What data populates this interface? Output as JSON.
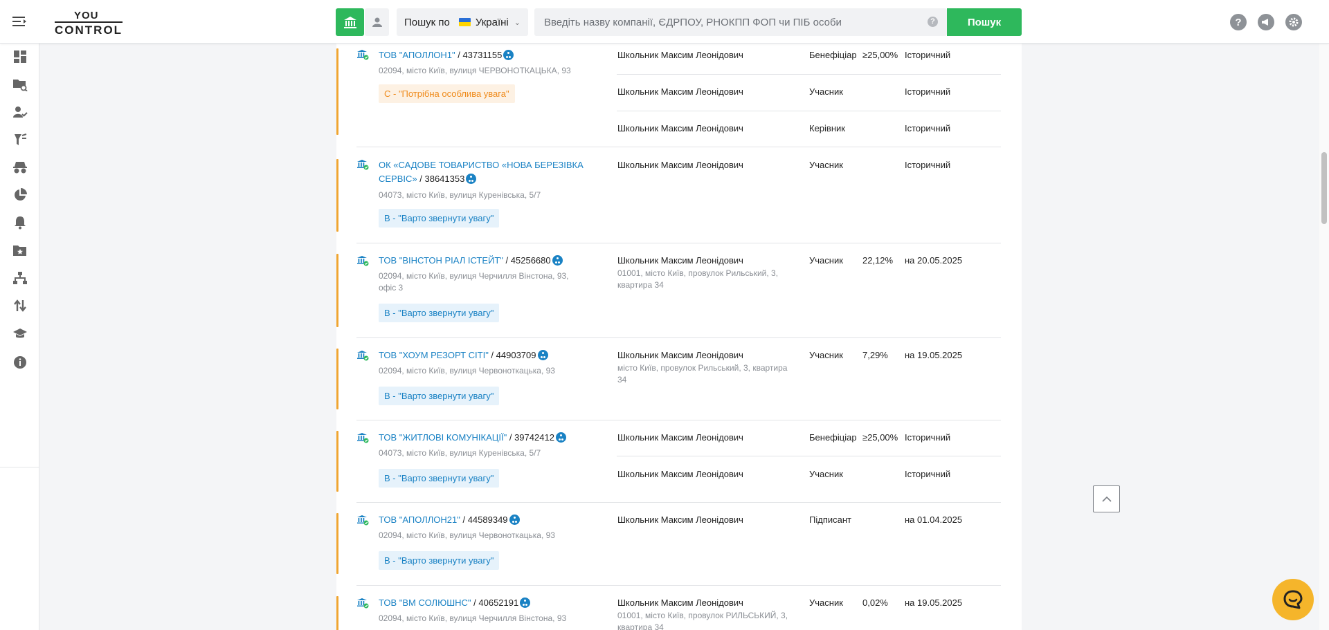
{
  "header": {
    "logo_top": "YOU",
    "logo_bottom": "CONTROL",
    "search_scope_label": "Пошук по",
    "country": "Україні",
    "search_placeholder": "Введіть назву компанії, ЄДРПОУ, РНОКПП ФОП чи ПІБ особи",
    "search_help": "?",
    "search_button": "Пошук",
    "icons": [
      "help-icon",
      "announcement-icon",
      "settings-icon"
    ],
    "accent_color": "#2eb85c"
  },
  "sidebar": {
    "icons": [
      "dashboard-icon",
      "folder-search-icon",
      "user-check-icon",
      "filter-icon",
      "spy-icon",
      "pie-chart-icon",
      "bell-icon",
      "folder-star-icon",
      "hierarchy-icon",
      "transfer-icon",
      "graduation-icon",
      "info-icon"
    ]
  },
  "entries": [
    {
      "name": "ТОВ \"АПОЛЛОН1\"",
      "code": "43731155",
      "address": "02094, місто Київ, вулиця ЧЕРВОНОТКАЦЬКА, 93",
      "badge": "C - \"Потрібна особлива увага\"",
      "relations": [
        {
          "person": "Школьник Максим Леонідович",
          "role": "Бенефіціар",
          "share": "≥25,00%",
          "status": "Історичний"
        },
        {
          "person": "Школьник Максим Леонідович",
          "role": "Учасник",
          "share": "",
          "status": "Історичний"
        },
        {
          "person": "Школьник Максим Леонідович",
          "role": "Керівник",
          "share": "",
          "status": "Історичний"
        }
      ]
    },
    {
      "name": "ОК «САДОВЕ ТОВАРИСТВО «НОВА БЕРЕЗІВКА СЕРВІС»",
      "code": "38641353",
      "address": "04073, місто Київ, вулиця Куренівська, 5/7",
      "badge": "B - \"Варто звернути увагу\"",
      "relations": [
        {
          "person": "Школьник Максим Леонідович",
          "role": "Учасник",
          "share": "",
          "status": "Історичний"
        }
      ]
    },
    {
      "name": "ТОВ \"ВІНСТОН РІАЛ ІСТЕЙТ\"",
      "code": "45256680",
      "address": "02094, місто Київ, вулиця Черчилля Вінстона, 93, офіс 3",
      "badge": "B - \"Варто звернути увагу\"",
      "relations": [
        {
          "person": "Школьник Максим Леонідович",
          "person_address": "01001, місто Київ, провулок Рильський, 3, квартира 34",
          "role": "Учасник",
          "share": "22,12%",
          "status": "на 20.05.2025"
        }
      ]
    },
    {
      "name": "ТОВ \"ХОУМ РЕЗОРТ СІТІ\"",
      "code": "44903709",
      "address": "02094, місто Київ, вулиця Червоноткацька, 93",
      "badge": "B - \"Варто звернути увагу\"",
      "relations": [
        {
          "person": "Школьник Максим Леонідович",
          "person_address": "місто Київ, провулок Рильський, 3, квартира 34",
          "role": "Учасник",
          "share": "7,29%",
          "status": "на 19.05.2025"
        }
      ]
    },
    {
      "name": "ТОВ \"ЖИТЛОВІ КОМУНІКАЦІЇ\"",
      "code": "39742412",
      "address": "04073, місто Київ, вулиця Куренівська, 5/7",
      "badge": "B - \"Варто звернути увагу\"",
      "relations": [
        {
          "person": "Школьник Максим Леонідович",
          "role": "Бенефіціар",
          "share": "≥25,00%",
          "status": "Історичний"
        },
        {
          "person": "Школьник Максим Леонідович",
          "role": "Учасник",
          "share": "",
          "status": "Історичний"
        }
      ]
    },
    {
      "name": "ТОВ \"АПОЛЛОН21\"",
      "code": "44589349",
      "address": "02094, місто Київ, вулиця Червоноткацька, 93",
      "badge": "B - \"Варто звернути увагу\"",
      "relations": [
        {
          "person": "Школьник Максим Леонідович",
          "role": "Підписант",
          "share": "",
          "status": "на 01.04.2025"
        }
      ]
    },
    {
      "name": "ТОВ \"ВМ СОЛЮШНС\"",
      "code": "40652191",
      "address": "02094, місто Київ, вулиця Черчилля Вінстона, 93",
      "badge": "",
      "relations": [
        {
          "person": "Школьник Максим Леонідович",
          "person_address": "01001, місто Київ, провулок РИЛЬСЬКИЙ, 3, квартира 34",
          "role": "Учасник",
          "share": "0,02%",
          "status": "на 19.05.2025"
        }
      ]
    }
  ]
}
